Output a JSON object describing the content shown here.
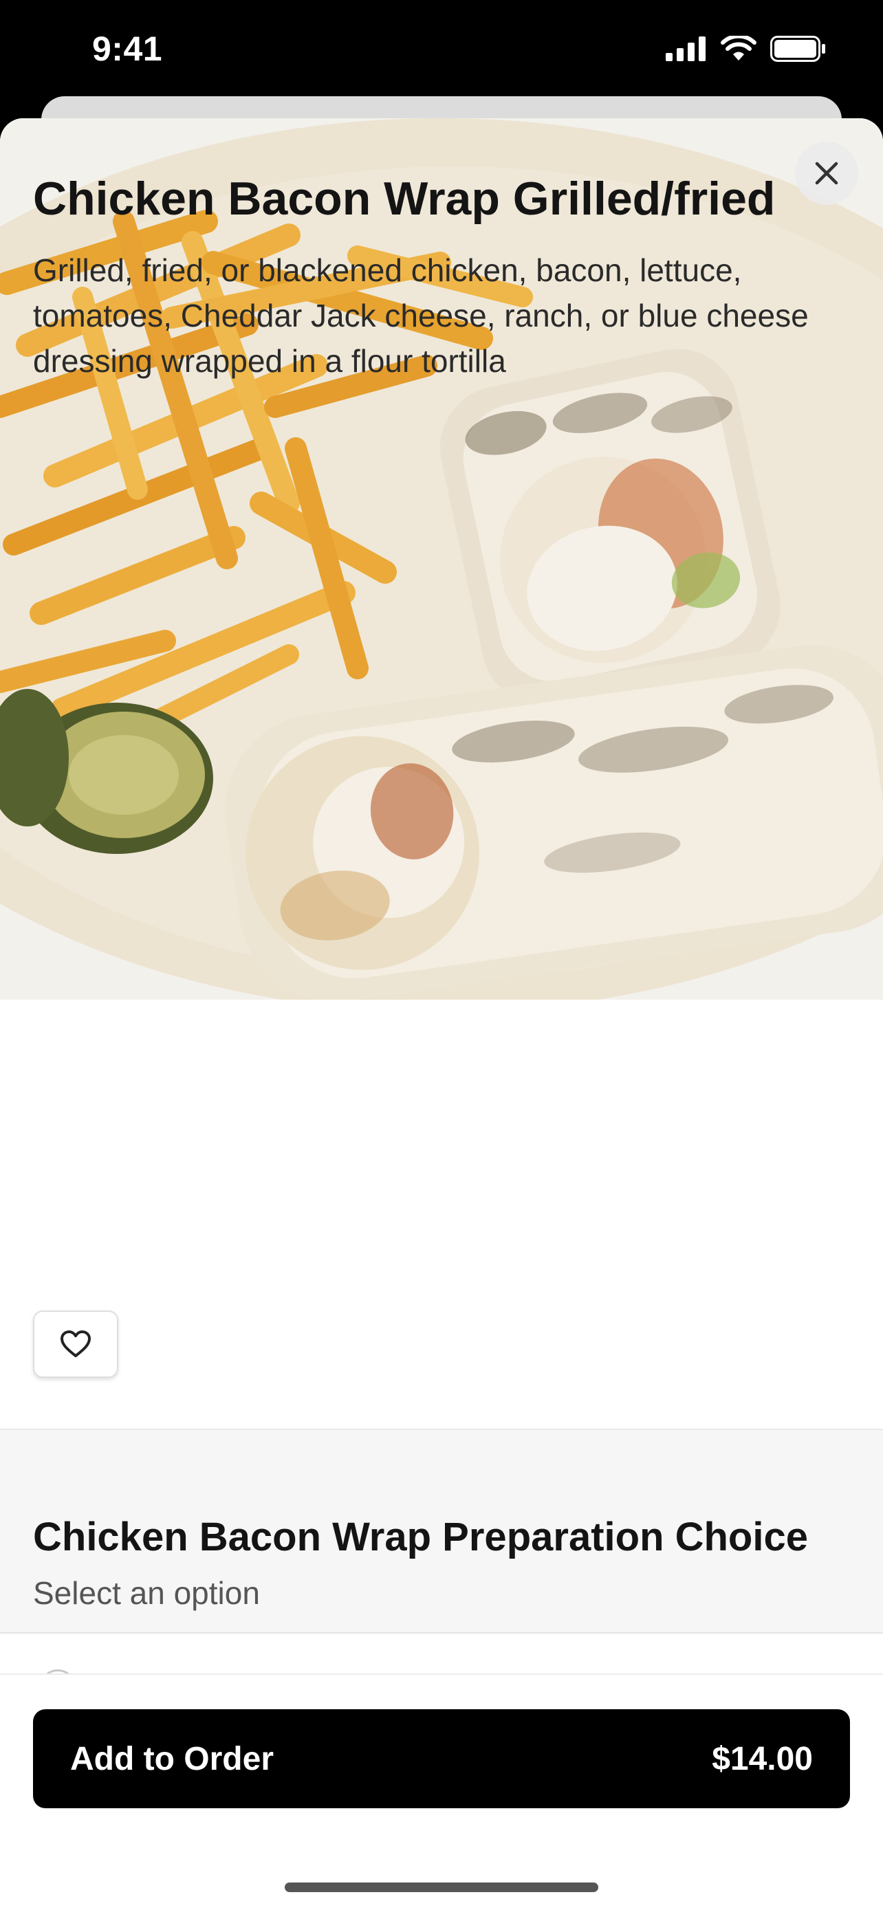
{
  "status_bar": {
    "time": "9:41",
    "icons": [
      "signal-icon",
      "wifi-icon",
      "battery-icon"
    ]
  },
  "item": {
    "title": "Chicken Bacon Wrap Grilled/fried",
    "description": "Grilled, fried, or blackened chicken, bacon, lettuce, tomatoes, Cheddar Jack cheese, ranch, or blue cheese dressing wrapped in a flour tortilla",
    "image": "food-photo"
  },
  "icons": {
    "close": "close-icon",
    "favorite": "heart-icon"
  },
  "options_section": {
    "title": "Chicken Bacon Wrap Preparation Choice",
    "subtitle": "Select an option"
  },
  "order_button": {
    "label": "Add to Order",
    "price": "$14.00"
  },
  "colors": {
    "primary_button": "#000000",
    "section_background": "#f6f6f6"
  }
}
